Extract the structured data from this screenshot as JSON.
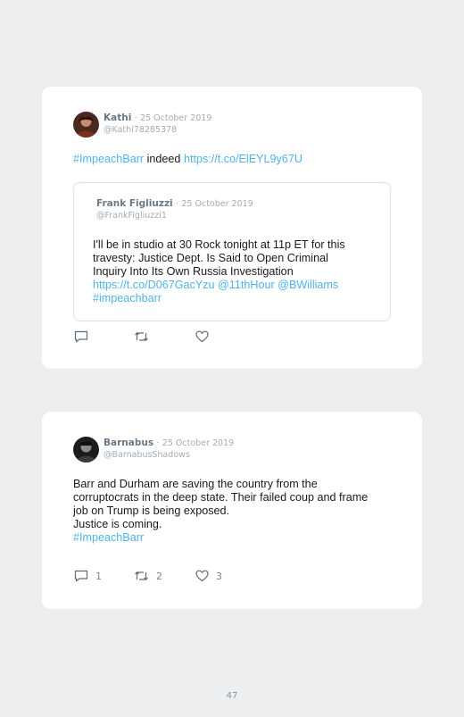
{
  "tweets": [
    {
      "author": "Kathi",
      "date": "25 October 2019",
      "handle": "@Kathi78285378",
      "text_parts": {
        "hashtag": "#ImpeachBarr",
        "word": " indeed ",
        "link": "https://t.co/ElEYL9y67U"
      },
      "quoted": {
        "author": "Frank Figliuzzi",
        "date": "25 October 2019",
        "handle": "@FrankFigliuzzi1",
        "lines": [
          "I'll be in studio at 30 Rock tonight at 11p ET for this",
          "travesty: Justice Dept. Is Said to Open Criminal",
          "Inquiry Into Its Own Russia Investigation"
        ],
        "link_line": "https://t.co/D067GacYzu @11thHour @BWilliams",
        "hashtag": "#impeachbarr"
      },
      "actions": {
        "reply": "",
        "retweet": "",
        "like": ""
      }
    },
    {
      "author": "Barnabus",
      "date": "25 October 2019",
      "handle": "@BarnabusShadows",
      "lines": [
        "Barr and Durham are saving the country from the",
        "corruptocrats in the deep state. Their failed coup and frame",
        "job on Trump is being exposed.",
        "Justice is coming."
      ],
      "hashtag": "#ImpeachBarr",
      "actions": {
        "reply": "1",
        "retweet": "2",
        "like": "3"
      }
    }
  ],
  "separator": "·",
  "page_number": "47",
  "colors": {
    "link": "#4fb3e8",
    "icon": "#5f6b78",
    "background": "#eceef0"
  }
}
